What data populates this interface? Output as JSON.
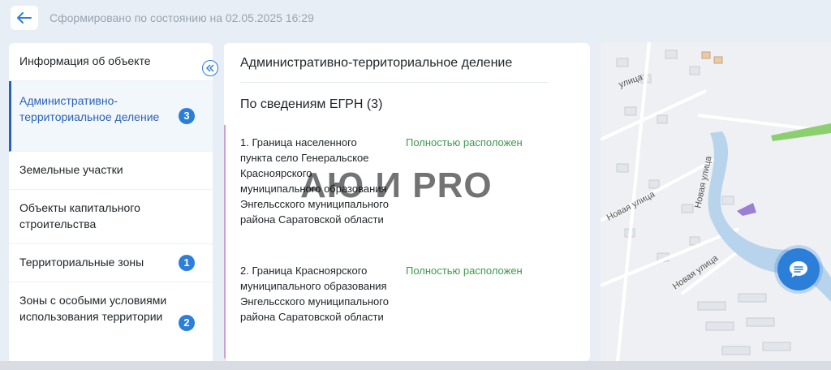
{
  "header": {
    "status_text": "Сформировано по состоянию на 02.05.2025 16:29"
  },
  "sidebar": {
    "items": [
      {
        "label": "Информация об объекте",
        "badge": ""
      },
      {
        "label": "Административно-территориальное деление",
        "badge": "3"
      },
      {
        "label": "Земельные участки",
        "badge": ""
      },
      {
        "label": "Объекты капитального строительства",
        "badge": ""
      },
      {
        "label": "Территориальные зоны",
        "badge": "1"
      },
      {
        "label": "Зоны с особыми условиями использования территории",
        "badge": "2"
      }
    ]
  },
  "main": {
    "title": "Административно-территориальное деление",
    "subtitle": "По сведениям ЕГРН (3)",
    "records": [
      {
        "text": "1. Граница населенного пункта село Генеральское Красноярского муниципального образования Энгельсского муниципального района Саратовской области",
        "status": "Полностью расположен"
      },
      {
        "text": "2. Граница Красноярского муниципального образования Энгельсского муниципального района Саратовской области",
        "status": "Полностью расположен"
      }
    ]
  },
  "watermark": "АЮ И PRO",
  "map": {
    "street_labels": [
      "улица",
      "Новая улица",
      "Новая улица",
      "Новая улица"
    ]
  },
  "icons": {
    "back": "arrow-left-icon",
    "collapse": "double-chevron-left-icon",
    "chat": "chat-bubble-icon"
  },
  "colors": {
    "accent": "#2b7fd9",
    "status_green": "#3c9a4a",
    "active_text": "#2b62b9"
  }
}
